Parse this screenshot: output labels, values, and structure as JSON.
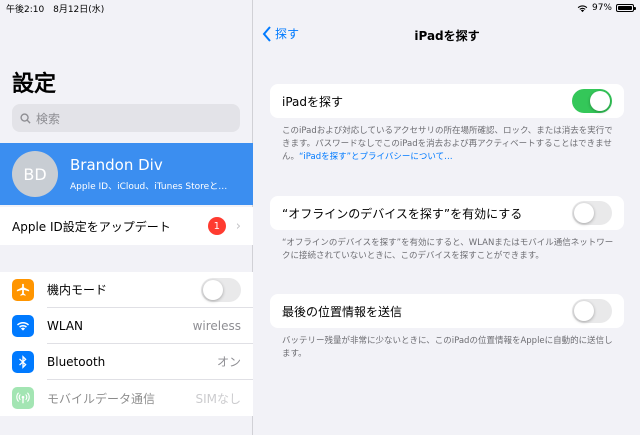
{
  "status": {
    "time": "午後2:10",
    "date": "8月12日(水)",
    "battery": "97%",
    "battery_level": 0.97
  },
  "sidebar": {
    "title": "設定",
    "search_placeholder": "検索",
    "profile": {
      "initials": "BD",
      "name": "Brandon Div",
      "subtitle": "Apple ID、iCloud、iTunes Storeと…"
    },
    "update": {
      "label": "Apple ID設定をアップデート",
      "badge": "1"
    },
    "items": [
      {
        "label": "機内モード",
        "icon": "airplane-icon",
        "color": "#ff9500",
        "toggle": false
      },
      {
        "label": "WLAN",
        "icon": "wifi-icon",
        "color": "#007aff",
        "value": "wireless"
      },
      {
        "label": "Bluetooth",
        "icon": "bluetooth-icon",
        "color": "#007aff",
        "value": "オン"
      },
      {
        "label": "モバイルデータ通信",
        "icon": "antenna-icon",
        "color": "#34c759",
        "value": "SIMなし",
        "dimmed": true
      }
    ]
  },
  "detail": {
    "back_label": "探す",
    "title": "iPadを探す",
    "find_ipad": {
      "label": "iPadを探す",
      "on": true,
      "note": "このiPadおよび対応しているアクセサリの所在場所確認、ロック、または消去を実行できます。パスワードなしでこのiPadを消去および再アクティベートすることはできません。",
      "link": "“iPadを探す”とプライバシーについて…"
    },
    "offline": {
      "label": "“オフラインのデバイスを探す”を有効にする",
      "on": false,
      "note": "“オフラインのデバイスを探す”を有効にすると、WLANまたはモバイル通信ネットワークに接続されていないときに、このデバイスを探すことができます。"
    },
    "last_location": {
      "label": "最後の位置情報を送信",
      "on": false,
      "note": "バッテリー残量が非常に少ないときに、このiPadの位置情報をAppleに自動的に送信します。"
    }
  }
}
